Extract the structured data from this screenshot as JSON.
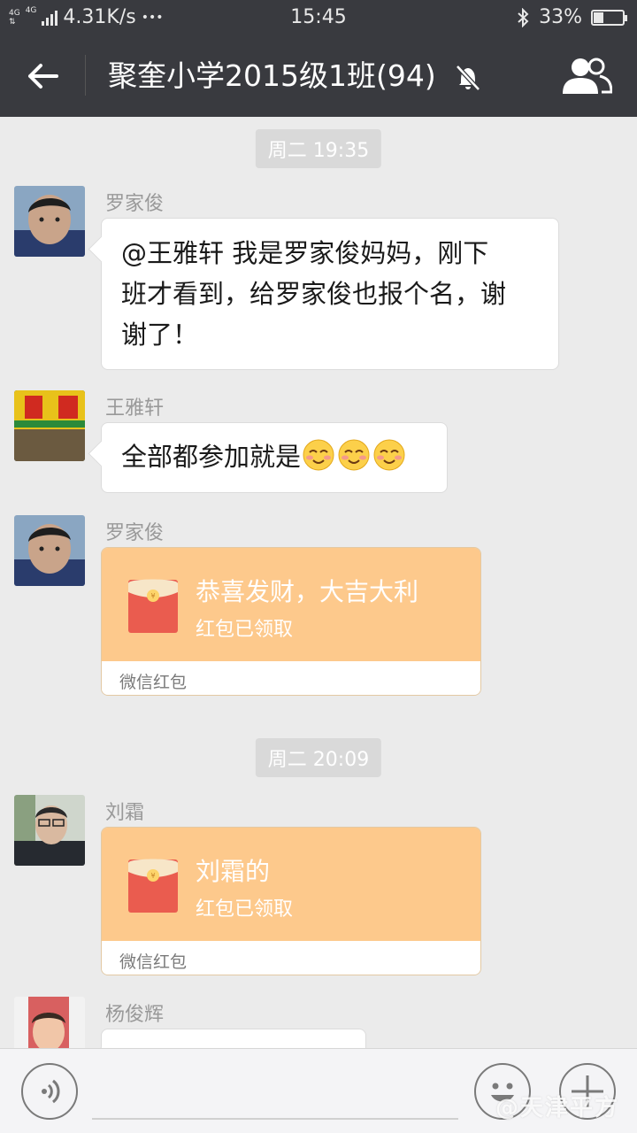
{
  "status_bar": {
    "network": "4G",
    "network2": "4G",
    "speed": "4.31K/s",
    "more": "•••",
    "time": "15:45",
    "battery_text": "33%",
    "battery_level": 0.33
  },
  "header": {
    "title": "聚奎小学2015级1班(94)",
    "muted": true
  },
  "messages": {
    "time1": "周二 19:35",
    "m1": {
      "sender": "罗家俊",
      "text_line1": "@王雅轩  我是罗家俊妈妈，刚下",
      "text_line2": "班才看到，给罗家俊也报个名，谢",
      "text_line3": "谢了！"
    },
    "m2": {
      "sender": "王雅轩",
      "text": "全部都参加就是",
      "emoji_count": 3
    },
    "m3": {
      "sender": "罗家俊",
      "packet_title": "恭喜发财，大吉大利",
      "packet_status": "红包已领取",
      "packet_footer": "微信红包"
    },
    "time2": "周二 20:09",
    "m4": {
      "sender": "刘霜",
      "packet_title": "刘霜的",
      "packet_status": "红包已领取",
      "packet_footer": "微信红包"
    },
    "m5": {
      "sender": "杨俊辉"
    }
  },
  "input_bar": {
    "watermark": "@天津平方"
  },
  "colors": {
    "header_bg": "#393a3f",
    "chat_bg": "#ebebeb",
    "packet_orange": "#fdc98c",
    "packet_red": "#ea5c4f"
  }
}
